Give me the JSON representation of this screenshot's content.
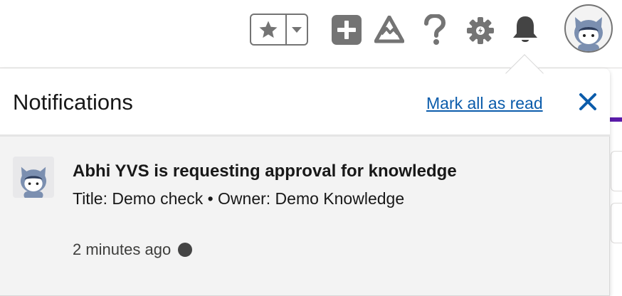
{
  "header": {
    "favorites_icon": "star-icon",
    "favorites_menu_icon": "chevron-down-icon",
    "global_actions_icon": "plus-icon",
    "trailhead_icon": "trailhead-icon",
    "help_icon": "question-icon",
    "setup_icon": "gear-icon",
    "notifications_icon": "bell-icon",
    "avatar_icon": "astro-avatar"
  },
  "panel": {
    "title": "Notifications",
    "mark_all_read": "Mark all as read",
    "close_icon": "close-icon"
  },
  "notifications": [
    {
      "title": "Abhi YVS is requesting approval for knowledge",
      "body": "Title: Demo check • Owner: Demo Knowledge",
      "time": "2 minutes ago",
      "unread": true
    }
  ],
  "colors": {
    "link": "#0b5cab",
    "icon_gray": "#747474",
    "accent_purple": "#5a1ba9"
  }
}
